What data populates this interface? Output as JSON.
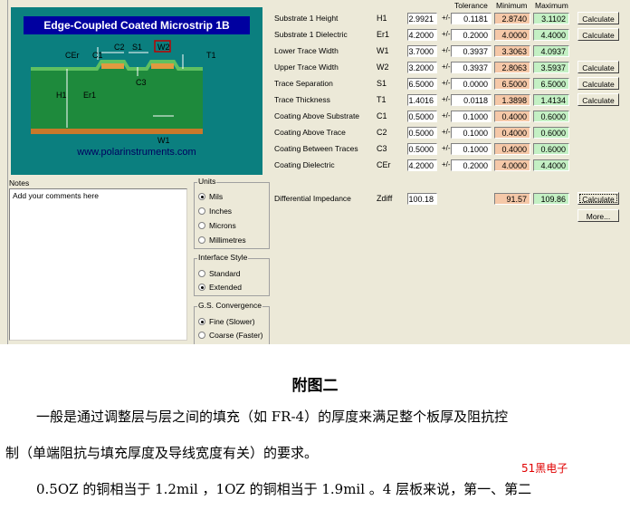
{
  "diagram": {
    "title": "Edge-Coupled Coated Microstrip 1B",
    "url": "www.polarinstruments.com",
    "labels": {
      "c2": "C2",
      "s1": "S1",
      "w2": "W2",
      "cer": "CEr",
      "c1": "C1",
      "t1": "T1",
      "c3": "C3",
      "h1": "H1",
      "er1": "Er1",
      "w1": "W1"
    }
  },
  "table": {
    "headers": {
      "tolerance": "Tolerance",
      "minimum": "Minimum",
      "maximum": "Maximum"
    },
    "pm": "+/-",
    "rows": [
      {
        "label": "Substrate 1 Height",
        "sym": "H1",
        "value": "2.9921",
        "tol": "0.1181",
        "min": "2.8740",
        "max": "3.1102",
        "button": "Calculate"
      },
      {
        "label": "Substrate 1 Dielectric",
        "sym": "Er1",
        "value": "4.2000",
        "tol": "0.2000",
        "min": "4.0000",
        "max": "4.4000",
        "button": "Calculate"
      },
      {
        "label": "Lower Trace Width",
        "sym": "W1",
        "value": "3.7000",
        "tol": "0.3937",
        "min": "3.3063",
        "max": "4.0937",
        "button": ""
      },
      {
        "label": "Upper Trace Width",
        "sym": "W2",
        "value": "3.2000",
        "tol": "0.3937",
        "min": "2.8063",
        "max": "3.5937",
        "button": "Calculate"
      },
      {
        "label": "Trace Separation",
        "sym": "S1",
        "value": "6.5000",
        "tol": "0.0000",
        "min": "6.5000",
        "max": "6.5000",
        "button": "Calculate"
      },
      {
        "label": "Trace Thickness",
        "sym": "T1",
        "value": "1.4016",
        "tol": "0.0118",
        "min": "1.3898",
        "max": "1.4134",
        "button": "Calculate"
      },
      {
        "label": "Coating Above Substrate",
        "sym": "C1",
        "value": "0.5000",
        "tol": "0.1000",
        "min": "0.4000",
        "max": "0.6000",
        "button": ""
      },
      {
        "label": "Coating Above Trace",
        "sym": "C2",
        "value": "0.5000",
        "tol": "0.1000",
        "min": "0.4000",
        "max": "0.6000",
        "button": ""
      },
      {
        "label": "Coating Between Traces",
        "sym": "C3",
        "value": "0.5000",
        "tol": "0.1000",
        "min": "0.4000",
        "max": "0.6000",
        "button": ""
      },
      {
        "label": "Coating Dielectric",
        "sym": "CEr",
        "value": "4.2000",
        "tol": "0.2000",
        "min": "4.0000",
        "max": "4.4000",
        "button": ""
      }
    ],
    "zdiff": {
      "label": "Differential Impedance",
      "sym": "Zdiff",
      "value": "100.18",
      "min": "91.57",
      "max": "109.86",
      "calc_button": "Calculate",
      "more_button": "More..."
    }
  },
  "notes": {
    "label": "Notes",
    "text": "Add your comments here"
  },
  "units": {
    "label": "Units",
    "options": [
      "Mils",
      "Inches",
      "Microns",
      "Millimetres"
    ],
    "selected": "Mils"
  },
  "interface_style": {
    "label": "Interface Style",
    "options": [
      "Standard",
      "Extended"
    ],
    "selected": "Extended"
  },
  "gs_convergence": {
    "label": "G.S. Convergence",
    "options": [
      "Fine (Slower)",
      "Coarse (Faster)"
    ],
    "selected": "Fine (Slower)"
  },
  "document": {
    "title": "附图二",
    "para1": "一般是通过调整层与层之间的填充（如 FR-4）的厚度来满足整个板厚及阻抗控",
    "para2": "制（单端阻抗与填充厚度及导线宽度有关）的要求。",
    "para3": "0.5OZ 的铜相当于 1.2mil ，1OZ 的铜相当于 1.9mil 。4 层板来说，第一、第二",
    "watermark": "51黑电子"
  }
}
